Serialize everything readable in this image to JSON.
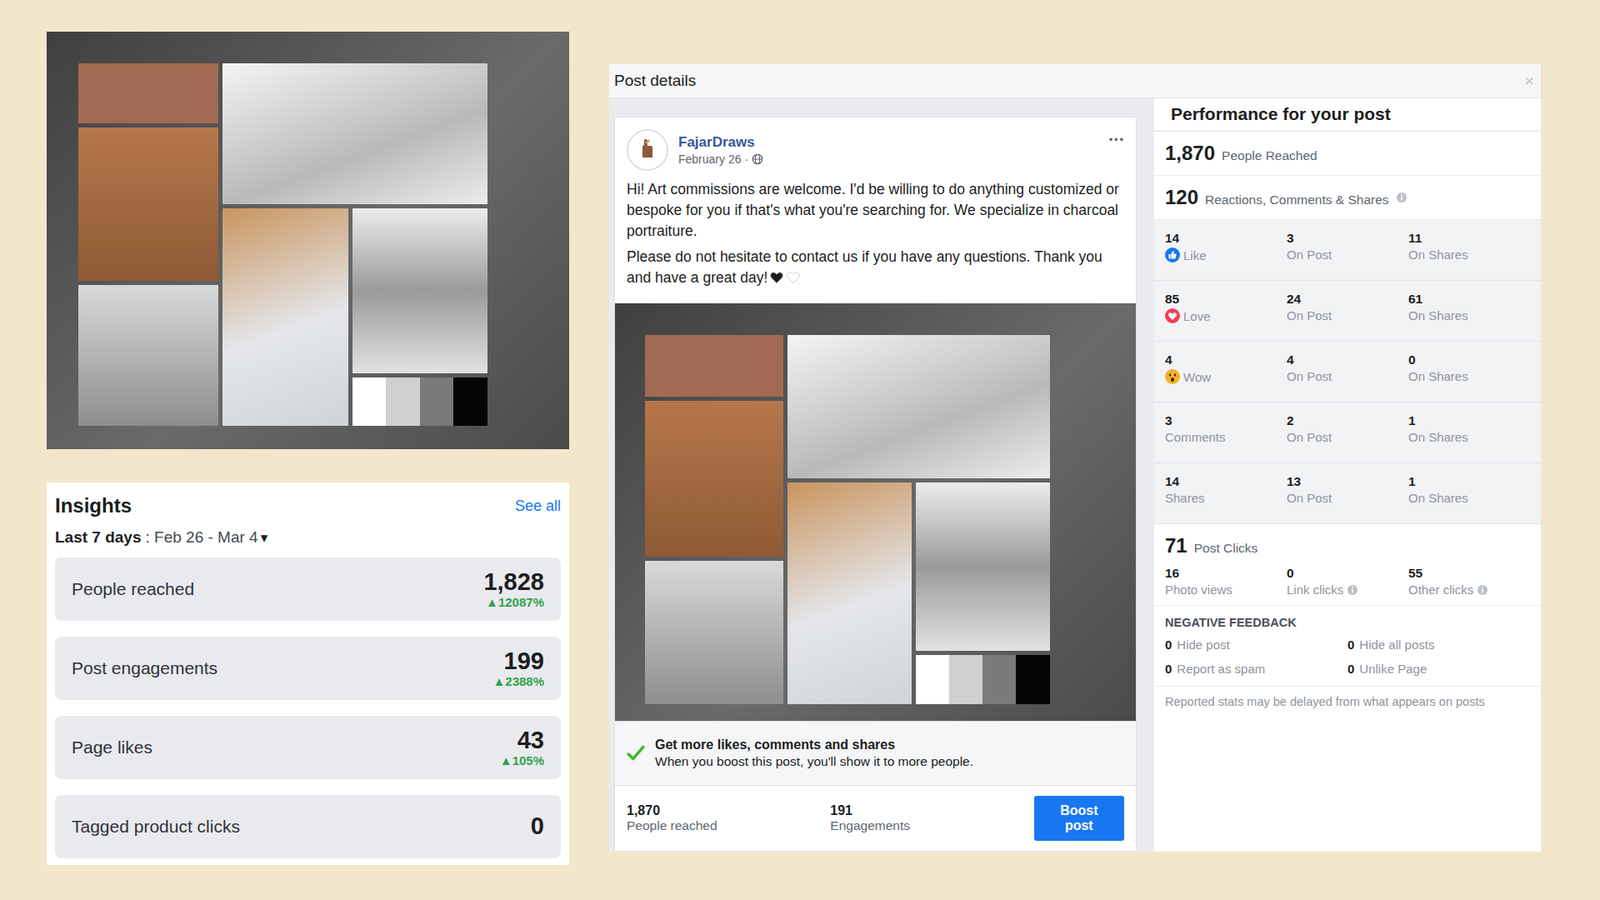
{
  "insights": {
    "title": "Insights",
    "see_all": "See all",
    "range_label": "Last 7 days",
    "range_dates": ": Feb 26 - Mar 4",
    "dropdown": "▾",
    "metrics": [
      {
        "label": "People reached",
        "value": "1,828",
        "change": "▲12087%"
      },
      {
        "label": "Post engagements",
        "value": "199",
        "change": "▲2388%"
      },
      {
        "label": "Page likes",
        "value": "43",
        "change": "▲105%"
      },
      {
        "label": "Tagged product clicks",
        "value": "0"
      }
    ]
  },
  "post_details": {
    "title": "Post details",
    "close": "×",
    "post": {
      "page_name": "FajarDraws",
      "date": "February 26",
      "separator": "·",
      "menu": "···",
      "paragraphs": [
        {
          "text": "Hi! Art commissions are welcome. I'd be willing to do anything customized or bespoke for you if that's what you're searching for. We specialize in charcoal portraiture.",
          "hearts": []
        },
        {
          "text": "Please do not hesitate to contact us if you have any questions. Thank you and have a great day!",
          "hearts": [
            {
              "color": "#1c1c1c"
            },
            {
              "color": "#ffffff"
            }
          ]
        }
      ],
      "boost_hint": {
        "title": "Get more likes, comments and shares",
        "text": "When you boost this post, you'll show it to more people."
      },
      "stats": [
        {
          "value": "1,870",
          "label": "People reached"
        },
        {
          "value": "191",
          "label": "Engagements"
        }
      ],
      "boost_button": "Boost post"
    },
    "performance": {
      "title": "Performance for your post",
      "reach": {
        "value": "1,870",
        "label": "People Reached"
      },
      "engagement": {
        "value": "120",
        "label": "Reactions, Comments & Shares"
      },
      "breakdown": [
        {
          "value": "14",
          "label": "Like",
          "kind": "like",
          "cells": [
            {
              "value": "3",
              "label": "On Post"
            },
            {
              "value": "11",
              "label": "On Shares"
            }
          ]
        },
        {
          "value": "85",
          "label": "Love",
          "kind": "love",
          "cells": [
            {
              "value": "24",
              "label": "On Post"
            },
            {
              "value": "61",
              "label": "On Shares"
            }
          ]
        },
        {
          "value": "4",
          "label": "Wow",
          "kind": "wow",
          "cells": [
            {
              "value": "4",
              "label": "On Post"
            },
            {
              "value": "0",
              "label": "On Shares"
            }
          ]
        },
        {
          "value": "3",
          "label": "Comments",
          "kind": "plain",
          "cells": [
            {
              "value": "2",
              "label": "On Post"
            },
            {
              "value": "1",
              "label": "On Shares"
            }
          ]
        },
        {
          "value": "14",
          "label": "Shares",
          "kind": "plain",
          "cells": [
            {
              "value": "13",
              "label": "On Post"
            },
            {
              "value": "1",
              "label": "On Shares"
            }
          ]
        }
      ],
      "clicks": {
        "value": "71",
        "label": "Post Clicks",
        "items": [
          {
            "value": "16",
            "label": "Photo views",
            "info": false
          },
          {
            "value": "0",
            "label": "Link clicks",
            "info": true
          },
          {
            "value": "55",
            "label": "Other clicks",
            "info": true
          }
        ]
      },
      "negative": {
        "title": "NEGATIVE FEEDBACK",
        "items": [
          {
            "value": "0",
            "label": "Hide post"
          },
          {
            "value": "0",
            "label": "Hide all posts"
          },
          {
            "value": "0",
            "label": "Report as spam"
          },
          {
            "value": "0",
            "label": "Unlike Page"
          }
        ]
      },
      "note": "Reported stats may be delayed from what appears on posts"
    }
  }
}
